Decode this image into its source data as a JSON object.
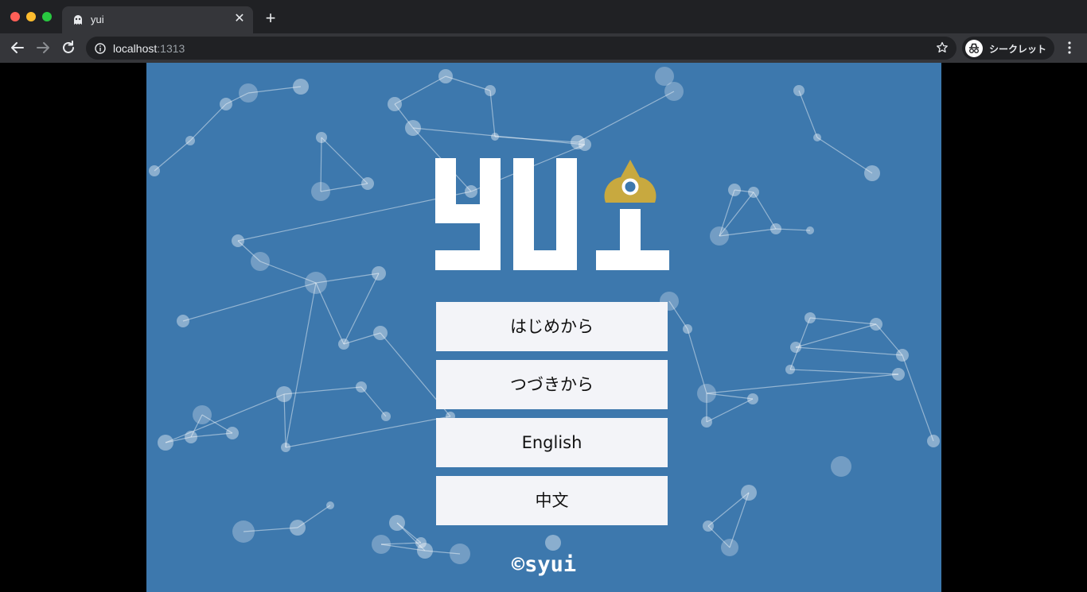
{
  "browser": {
    "tab": {
      "title": "yui",
      "close_glyph": "✕",
      "favicon": "ghost-icon"
    },
    "new_tab_glyph": "+",
    "url": {
      "host": "localhost",
      "port": ":1313"
    },
    "profile_label": "シークレット"
  },
  "page": {
    "background_color": "#3d78ad",
    "logo_text": "yui",
    "logo_accent_color": "#c8a93f",
    "menu": [
      {
        "label": "はじめから"
      },
      {
        "label": "つづきから"
      },
      {
        "label": "English"
      },
      {
        "label": "中文"
      }
    ],
    "copyright": "©syui"
  }
}
